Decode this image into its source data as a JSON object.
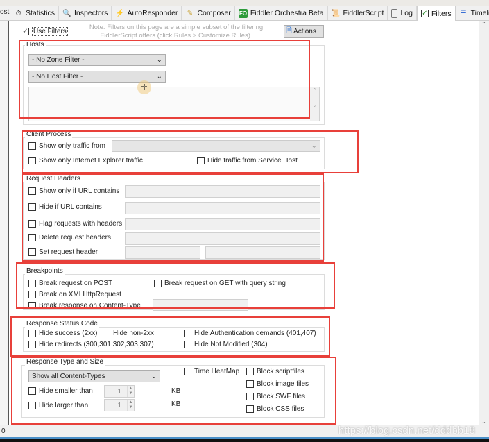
{
  "tabs": [
    {
      "label": "Statistics",
      "icon": "stopwatch-icon"
    },
    {
      "label": "Inspectors",
      "icon": "magnifier-icon"
    },
    {
      "label": "AutoResponder",
      "icon": "lightning-icon"
    },
    {
      "label": "Composer",
      "icon": "pencil-icon"
    },
    {
      "label": "Fiddler Orchestra Beta",
      "icon": "fo-icon",
      "icon_text": "FO"
    },
    {
      "label": "FiddlerScript",
      "icon": "script-icon"
    },
    {
      "label": "Log",
      "icon": "log-icon"
    },
    {
      "label": "Filters",
      "icon": "checkbox-icon",
      "active": true
    },
    {
      "label": "Timeline",
      "icon": "timeline-icon"
    }
  ],
  "left_cut": "ost",
  "use_filters": {
    "label": "Use Filters",
    "checked": true
  },
  "note": "Note: Filters on this page are a simple subset of the filtering FiddlerScript offers (click Rules > Customize Rules).",
  "actions_label": "Actions",
  "hosts": {
    "title": "Hosts",
    "zone_filter": "- No Zone Filter -",
    "host_filter": "- No Host Filter -"
  },
  "client_process": {
    "title": "Client Process",
    "show_only_from": "Show only traffic from",
    "show_only_ie": "Show only Internet Explorer traffic",
    "hide_service_host": "Hide traffic from Service Host"
  },
  "request_headers": {
    "title": "Request Headers",
    "rows": [
      "Show only if URL contains",
      "Hide if URL contains",
      "Flag requests with headers",
      "Delete request headers",
      "Set request header"
    ]
  },
  "breakpoints": {
    "title": "Breakpoints",
    "post": "Break request on POST",
    "get": "Break request on GET with query string",
    "xhr": "Break on XMLHttpRequest",
    "content_type": "Break response on Content-Type"
  },
  "status_code": {
    "title": "Response Status Code",
    "success": "Hide success (2xx)",
    "non2xx": "Hide non-2xx",
    "auth": "Hide Authentication demands (401,407)",
    "redirects": "Hide redirects (300,301,302,303,307)",
    "not_modified": "Hide Not Modified (304)"
  },
  "response_type": {
    "title": "Response Type and Size",
    "content_types": "Show all Content-Types",
    "hide_smaller": "Hide smaller than",
    "hide_larger": "Hide larger than",
    "smaller_value": "1",
    "larger_value": "1",
    "unit": "KB",
    "heatmap": "Time HeatMap",
    "block_script": "Block scriptfiles",
    "block_image": "Block image files",
    "block_swf": "Block SWF files",
    "block_css": "Block CSS files"
  },
  "status_bar": {
    "left": "0"
  },
  "watermark": "https://blog.csdn.net/dddbb18",
  "colors": {
    "highlight_box": "#e8403a",
    "fo_icon": "#2e9b3a"
  }
}
